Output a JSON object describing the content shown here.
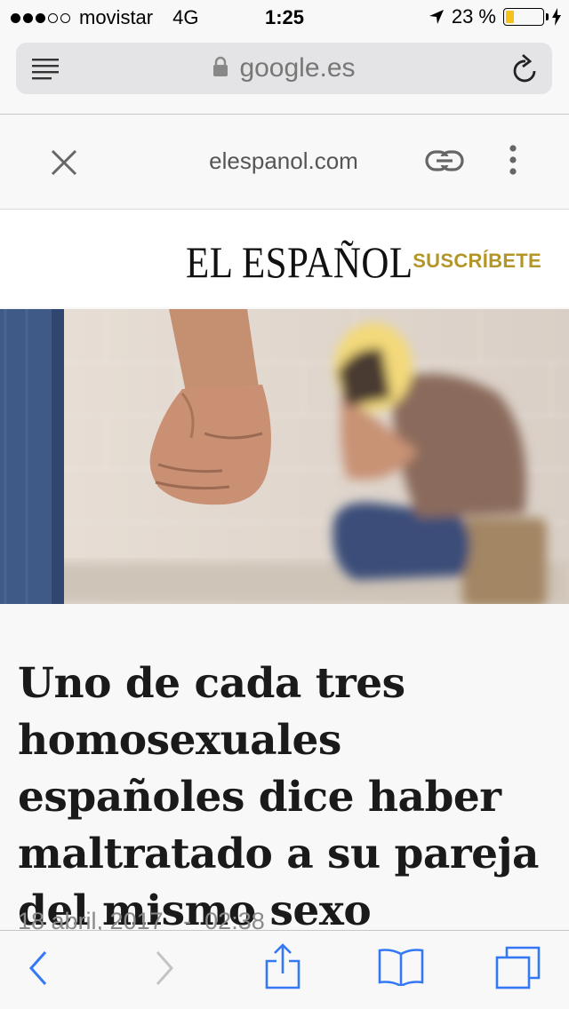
{
  "status_bar": {
    "carrier": "movistar",
    "network": "4G",
    "time": "1:25",
    "battery_percent": "23 %",
    "battery_level": 0.23,
    "signal_strength": 3,
    "signal_max": 5
  },
  "browser": {
    "url": "google.es"
  },
  "viewer": {
    "domain": "elespanol.com"
  },
  "publisher": {
    "logo": "EL ESPAÑOL",
    "subscribe_label": "SUSCRÍBETE",
    "accent_color": "#b49628"
  },
  "article": {
    "headline": "Uno de cada tres homosexuales españoles dice haber maltratado a su pareja del mismo sexo",
    "date": "18 abril, 2017",
    "separator": "-",
    "time": "02:38"
  },
  "icons": {
    "reader": "reader-view-icon",
    "lock": "lock-icon",
    "reload": "reload-icon",
    "close": "close-icon",
    "link": "link-icon",
    "more": "more-vertical-icon",
    "back": "chevron-left-icon",
    "forward": "chevron-right-icon",
    "share": "share-icon",
    "bookmarks": "bookmarks-icon",
    "tabs": "tabs-icon"
  },
  "colors": {
    "ios_blue": "#3478f6"
  }
}
